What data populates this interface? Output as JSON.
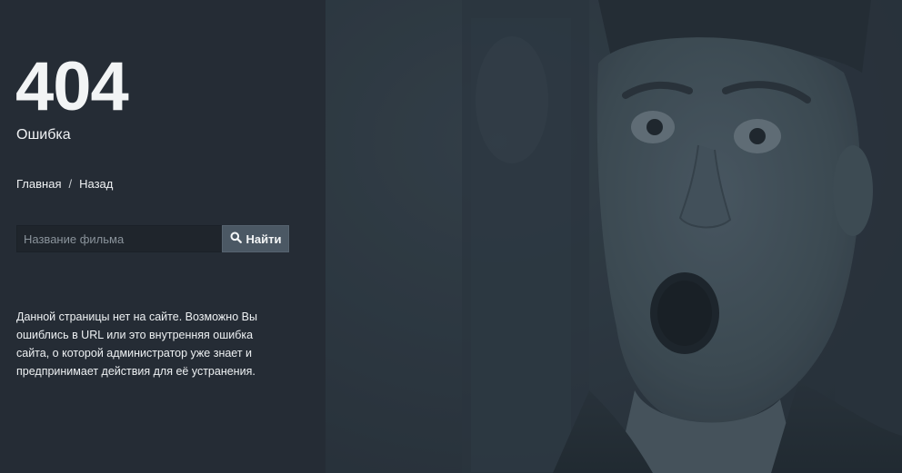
{
  "error": {
    "code": "404",
    "label": "Ошибка"
  },
  "breadcrumb": {
    "home": "Главная",
    "separator": "/",
    "back": "Назад"
  },
  "search": {
    "placeholder": "Название фильма",
    "button_label": "Найти",
    "button_icon": "search-icon"
  },
  "description": "Данной страницы нет на сайте. Возможно Вы ошиблись в URL или это внутренняя ошибка сайта, о которой администратор уже знает и предпринимает действия для её устранения.",
  "colors": {
    "panel_background": "#252c35",
    "button_background": "#4b5864",
    "text": "#f0f2f4"
  }
}
